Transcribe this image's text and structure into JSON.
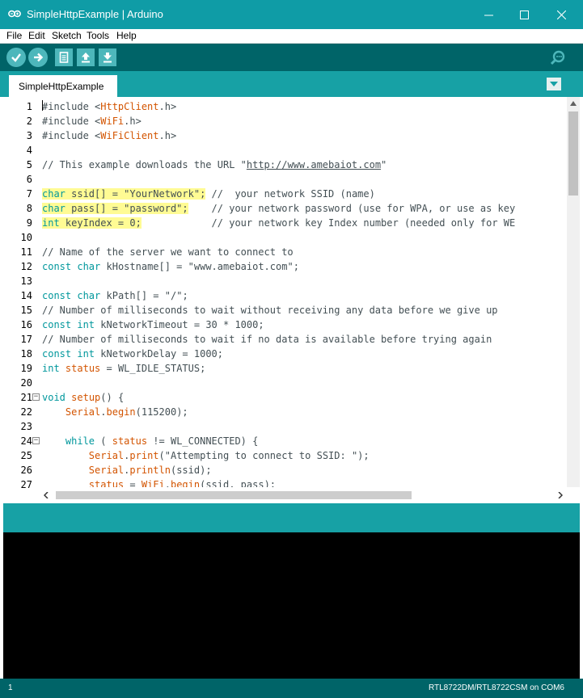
{
  "window": {
    "title": "SimpleHttpExample | Arduino",
    "title_bar_color": "#0f9ca6"
  },
  "menu": [
    "File",
    "Edit",
    "Sketch",
    "Tools",
    "Help"
  ],
  "toolbar": {
    "buttons": [
      "verify-icon",
      "upload-icon",
      "new-icon",
      "open-icon",
      "save-icon",
      "serial-monitor-icon"
    ],
    "background": "#006468",
    "button_color": "#4db7bb"
  },
  "tabs": [
    {
      "label": "SimpleHttpExample"
    }
  ],
  "editor": {
    "lines": [
      "#include <HttpClient.h>",
      "#include <WiFi.h>",
      "#include <WiFiClient.h>",
      "",
      "// This example downloads the URL \"http://www.amebaiot.com\"",
      "",
      "char ssid[] = \"YourNetwork\"; //  your network SSID (name)",
      "char pass[] = \"password\";    // your network password (use for WPA, or use as key",
      "int keyIndex = 0;            // your network key Index number (needed only for WE",
      "",
      "// Name of the server we want to connect to",
      "const char kHostname[] = \"www.amebaiot.com\";",
      "",
      "const char kPath[] = \"/\";",
      "// Number of milliseconds to wait without receiving any data before we give up",
      "const int kNetworkTimeout = 30 * 1000;",
      "// Number of milliseconds to wait if no data is available before trying again",
      "const int kNetworkDelay = 1000;",
      "int status = WL_IDLE_STATUS;",
      "",
      "void setup() {",
      "    Serial.begin(115200);",
      "",
      "    while ( status != WL_CONNECTED) {",
      "        Serial.print(\"Attempting to connect to SSID: \");",
      "        Serial.println(ssid);",
      "        status = WiFi.begin(ssid, pass);"
    ],
    "highlighted_lines": [
      7,
      8,
      9
    ],
    "highlight_color": "#fffb94",
    "folded_lines": [
      21,
      24
    ]
  },
  "statusbar": {
    "line_number": "1",
    "board": "RTL8722DM/RTL8722CSM on COM6"
  }
}
